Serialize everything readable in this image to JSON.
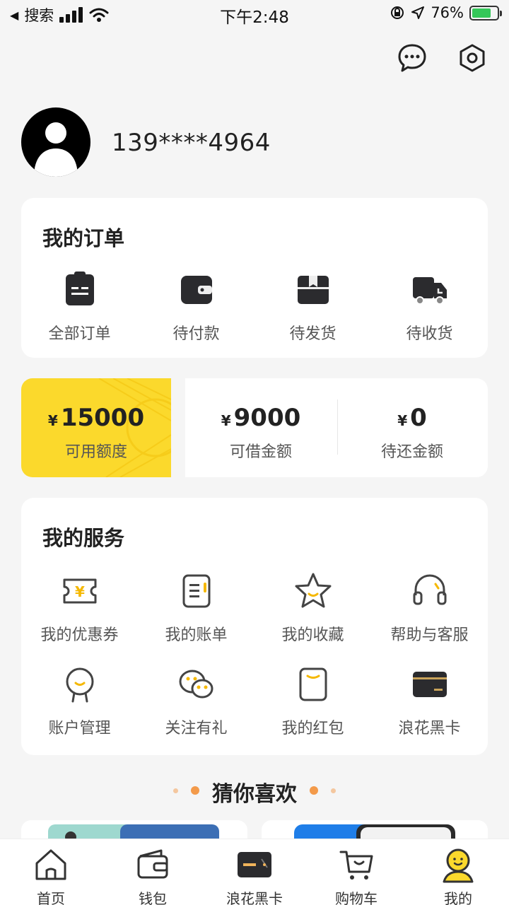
{
  "status_bar": {
    "back_label": "搜索",
    "time": "下午2:48",
    "battery": "76%"
  },
  "profile": {
    "phone": "139****4964"
  },
  "orders": {
    "title": "我的订单",
    "items": [
      {
        "label": "全部订单",
        "icon": "clipboard-icon"
      },
      {
        "label": "待付款",
        "icon": "wallet-icon"
      },
      {
        "label": "待发货",
        "icon": "box-icon"
      },
      {
        "label": "待收货",
        "icon": "truck-icon"
      }
    ]
  },
  "credit": {
    "available": {
      "currency": "¥",
      "value": "15000",
      "label": "可用额度"
    },
    "borrowable": {
      "currency": "¥",
      "value": "9000",
      "label": "可借金额"
    },
    "repay": {
      "currency": "¥",
      "value": "0",
      "label": "待还金额"
    }
  },
  "services": {
    "title": "我的服务",
    "items": [
      {
        "label": "我的优惠券",
        "icon": "coupon-icon"
      },
      {
        "label": "我的账单",
        "icon": "bill-icon"
      },
      {
        "label": "我的收藏",
        "icon": "star-icon"
      },
      {
        "label": "帮助与客服",
        "icon": "headset-icon"
      },
      {
        "label": "账户管理",
        "icon": "account-icon"
      },
      {
        "label": "关注有礼",
        "icon": "wechat-icon"
      },
      {
        "label": "我的红包",
        "icon": "red-packet-icon"
      },
      {
        "label": "浪花黑卡",
        "icon": "black-card-icon"
      }
    ]
  },
  "recommend": {
    "title": "猜你喜欢"
  },
  "tabs": [
    {
      "label": "首页",
      "icon": "home-icon"
    },
    {
      "label": "钱包",
      "icon": "wallet-icon"
    },
    {
      "label": "浪花黑卡",
      "icon": "black-card-icon"
    },
    {
      "label": "购物车",
      "icon": "cart-icon"
    },
    {
      "label": "我的",
      "icon": "profile-icon"
    }
  ],
  "colors": {
    "accent": "#fbd92c",
    "highlight": "#f5b800",
    "dot": "#f39a4a"
  }
}
